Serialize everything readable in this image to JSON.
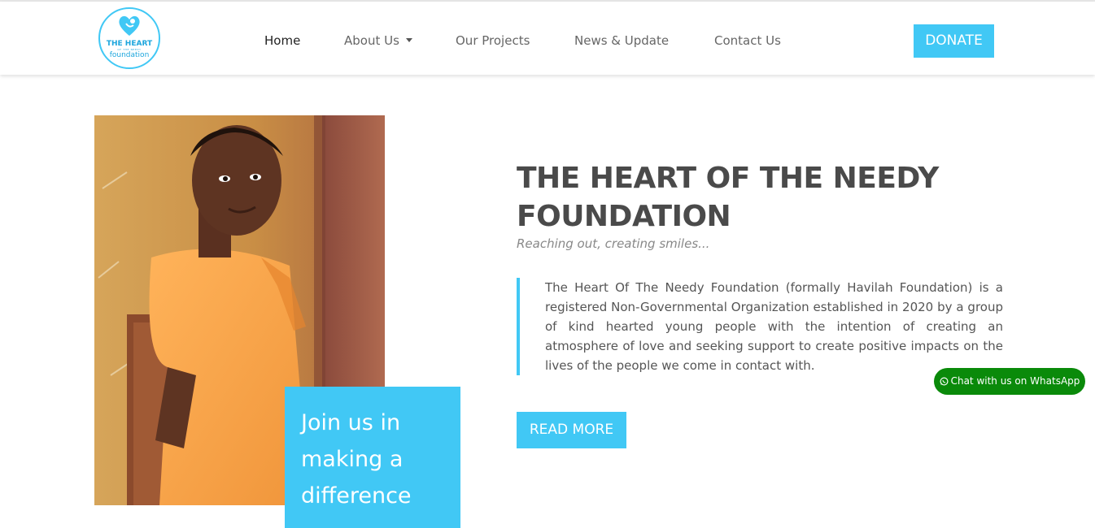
{
  "logo": {
    "line1": "THE HEART",
    "line2": "OF THE NEEDY",
    "line3": "foundation"
  },
  "nav": {
    "items": [
      "Home",
      "About Us",
      "Our Projects",
      "News & Update",
      "Contact Us"
    ],
    "donate_label": "DONATE"
  },
  "hero": {
    "join_line1": "Join us in",
    "join_line2": "making a",
    "join_line3": "difference",
    "title_line1": "THE HEART OF THE NEEDY",
    "title_line2": "FOUNDATION",
    "tagline": "Reaching out, creating smiles...",
    "description": "The Heart Of The Needy Foundation (formally Havilah Foundation) is a registered Non-Governmental Organization established in 2020 by a group of kind hearted young people with the intention of creating an atmosphere of love and seeking support to create positive impacts on the lives of the people we come in contact with.",
    "read_more_label": "READ MORE"
  },
  "whatsapp": {
    "label": "Chat with us on WhatsApp"
  },
  "colors": {
    "accent": "#41c8f5",
    "heading": "#4a4a4a",
    "whatsapp": "#0a8a0a"
  },
  "icons": {
    "caret": "chevron-down-icon",
    "whatsapp": "whatsapp-icon"
  }
}
